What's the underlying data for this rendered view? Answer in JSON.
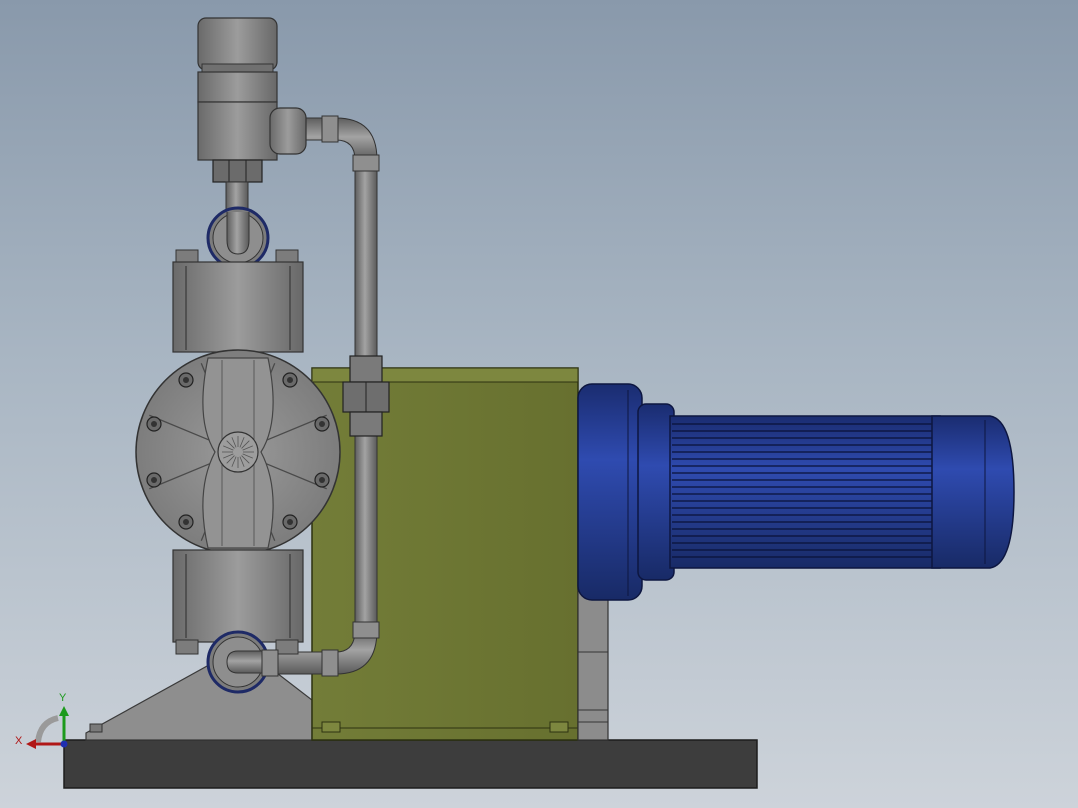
{
  "view": {
    "background_top": "#8999ab",
    "background_bottom": "#cdd3da"
  },
  "colors": {
    "gearbox_housing": "#6f7a35",
    "motor_blue": "#233a8e",
    "steel_gray": "#8a8a8a",
    "base_plate": "#3d3d3d",
    "axis_x": "#b01717",
    "axis_y": "#1c9a1c"
  },
  "triad": {
    "x_label": "X",
    "y_label": "Y"
  }
}
